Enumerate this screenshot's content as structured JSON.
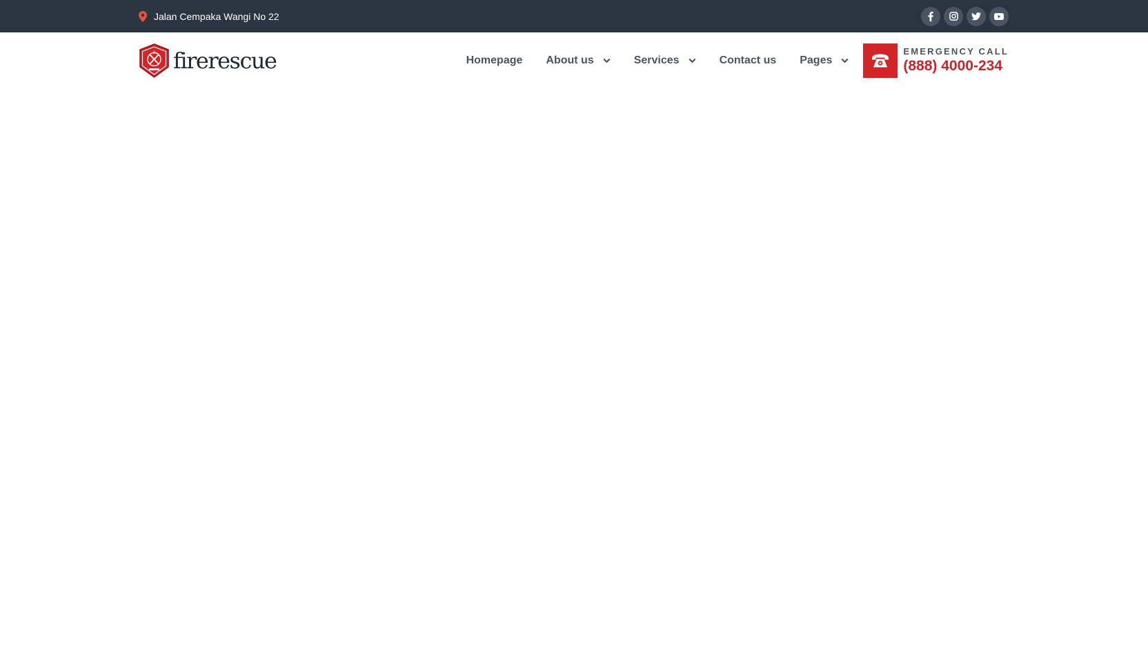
{
  "topbar": {
    "address": "Jalan Cempaka Wangi No 22",
    "address_icon": "map-pin-icon",
    "socials": [
      {
        "name": "facebook",
        "icon": "facebook-icon"
      },
      {
        "name": "instagram",
        "icon": "instagram-icon"
      },
      {
        "name": "twitter",
        "icon": "twitter-icon"
      },
      {
        "name": "youtube",
        "icon": "youtube-icon"
      }
    ]
  },
  "header": {
    "logo_text": "firerescue",
    "nav": [
      {
        "label": "Homepage",
        "has_dropdown": false
      },
      {
        "label": "About us",
        "has_dropdown": true
      },
      {
        "label": "Services",
        "has_dropdown": true
      },
      {
        "label": "Contact us",
        "has_dropdown": false
      },
      {
        "label": "Pages",
        "has_dropdown": true
      }
    ],
    "emergency": {
      "label": "EMERGENCY CALL",
      "number": "(888) 4000-234",
      "icon": "phone-icon"
    }
  },
  "colors": {
    "topbar_bg": "#2a3541",
    "accent_red": "#d32428",
    "nav_text": "#4a5560",
    "social_circle": "#4b5562",
    "pin": "#e8523a"
  }
}
